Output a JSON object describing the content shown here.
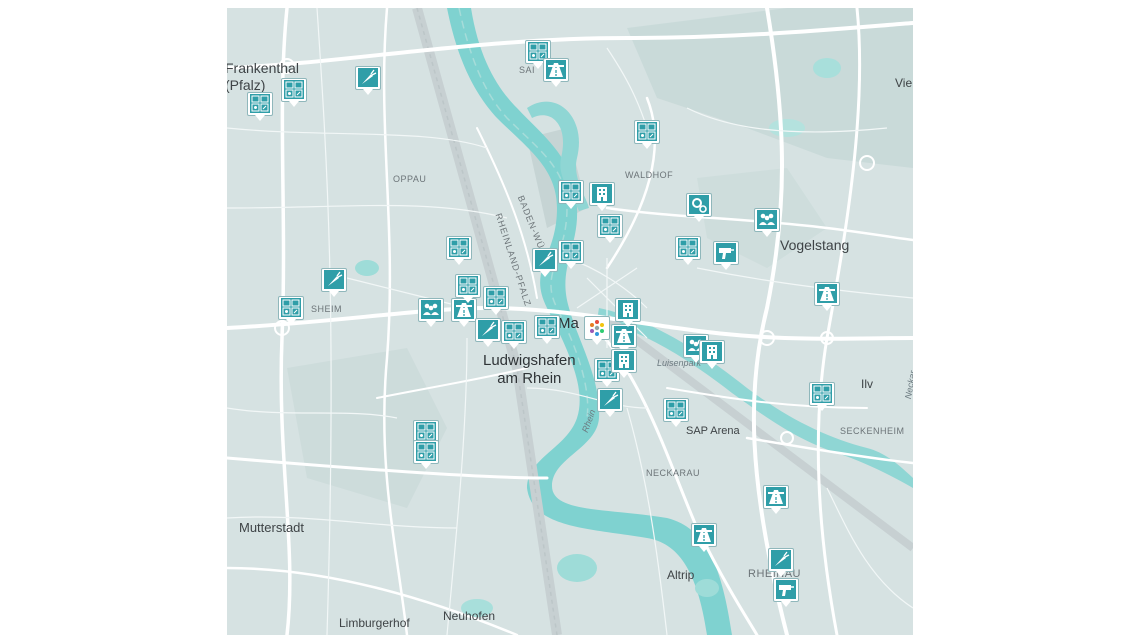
{
  "map": {
    "places": [
      {
        "id": "frankenthal",
        "label": "Frankenthal\n(Pfalz)",
        "kind": "city"
      },
      {
        "id": "vogelstang",
        "label": "Vogelstang",
        "kind": "city"
      },
      {
        "id": "ludwigshafen",
        "label": "Ludwigshafen\nam Rhein",
        "kind": "big"
      },
      {
        "id": "mannheim",
        "label": "Ma",
        "kind": "big"
      },
      {
        "id": "mutterstadt",
        "label": "Mutterstadt",
        "kind": "city"
      },
      {
        "id": "altrip",
        "label": "Altrip",
        "kind": "city"
      },
      {
        "id": "neuhofen",
        "label": "Neuhofen",
        "kind": "city"
      },
      {
        "id": "limburgerhof",
        "label": "Limburgerhof",
        "kind": "city"
      },
      {
        "id": "oppau",
        "label": "OPPAU",
        "kind": "district"
      },
      {
        "id": "waldhof",
        "label": "WALDHOF",
        "kind": "district"
      },
      {
        "id": "sheim",
        "label": "SHEIM",
        "kind": "district"
      },
      {
        "id": "neckarau",
        "label": "NECKARAU",
        "kind": "district"
      },
      {
        "id": "seckenheim",
        "label": "SECKENHEIM",
        "kind": "district"
      },
      {
        "id": "rheinau",
        "label": "RHEINAU",
        "kind": "district"
      },
      {
        "id": "luisenpark",
        "label": "Luisenpark",
        "kind": "river"
      },
      {
        "id": "sap-arena",
        "label": "SAP Arena",
        "kind": "city-small"
      },
      {
        "id": "rhein",
        "label": "Rhein",
        "kind": "river"
      },
      {
        "id": "vie",
        "label": "Vie",
        "kind": "city"
      },
      {
        "id": "ilv",
        "label": "Ilv",
        "kind": "city"
      },
      {
        "id": "baden-wurt",
        "label": "BADEN-WÜRT",
        "kind": "rot"
      },
      {
        "id": "rheinland-pfalz",
        "label": "RHEINLAND-PFALZ",
        "kind": "rot"
      },
      {
        "id": "neckar",
        "label": "Neckar",
        "kind": "river"
      },
      {
        "id": "sai",
        "label": "SAI",
        "kind": "district"
      }
    ],
    "colors": {
      "land": "#d6e2e2",
      "water": "#6fc9c8",
      "road": "#ffffff",
      "marker": "#2f9ea8"
    },
    "markers": [
      {
        "type": "shop-grid"
      },
      {
        "type": "shop-grid"
      },
      {
        "type": "carrot"
      },
      {
        "type": "shop-grid"
      },
      {
        "type": "highway"
      },
      {
        "type": "shop-grid"
      },
      {
        "type": "shop-grid"
      },
      {
        "type": "building"
      },
      {
        "type": "gear"
      },
      {
        "type": "people"
      },
      {
        "type": "shop-grid"
      },
      {
        "type": "shop-grid"
      },
      {
        "type": "drill"
      },
      {
        "type": "highway"
      },
      {
        "type": "shop-grid"
      },
      {
        "type": "carrot"
      },
      {
        "type": "shop-grid"
      },
      {
        "type": "people"
      },
      {
        "type": "highway"
      },
      {
        "type": "shop-grid"
      },
      {
        "type": "carrot"
      },
      {
        "type": "shop-grid"
      },
      {
        "type": "shop-grid"
      },
      {
        "type": "shop-grid"
      },
      {
        "type": "colorful"
      },
      {
        "type": "highway"
      },
      {
        "type": "building"
      },
      {
        "type": "people"
      },
      {
        "type": "building"
      },
      {
        "type": "shop-grid"
      },
      {
        "type": "carrot"
      },
      {
        "type": "shop-grid"
      },
      {
        "type": "shop-grid"
      },
      {
        "type": "shop-grid"
      },
      {
        "type": "shop-grid"
      },
      {
        "type": "highway"
      },
      {
        "type": "highway"
      },
      {
        "type": "carrot"
      },
      {
        "type": "drill"
      },
      {
        "type": "building"
      },
      {
        "type": "carrot"
      },
      {
        "type": "shop-grid"
      }
    ]
  }
}
